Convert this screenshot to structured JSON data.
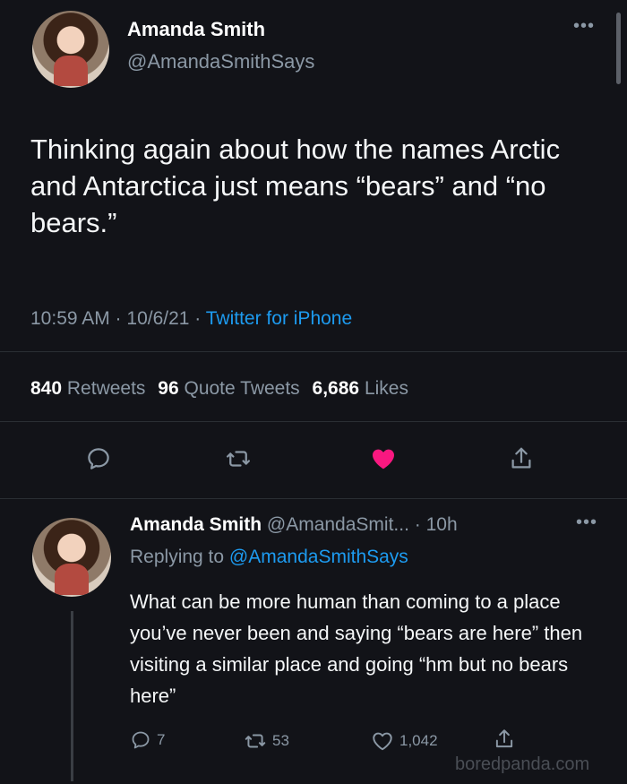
{
  "tweet": {
    "author_name": "Amanda Smith",
    "author_handle": "@AmandaSmithSays",
    "more_label": "•••",
    "text": "Thinking again about how the names Arctic and Antarctica just means “bears” and “no bears.”",
    "time": "10:59 AM · 10/6/21 · ",
    "source": "Twitter for iPhone",
    "stats": {
      "retweets_count": "840",
      "retweets_label": "Retweets",
      "quotes_count": "96",
      "quotes_label": "Quote Tweets",
      "likes_count": "6,686",
      "likes_label": "Likes"
    },
    "actions": [
      "reply-icon",
      "retweet-icon",
      "heart-icon",
      "share-icon"
    ],
    "liked": true,
    "colors": {
      "like": "#f91880",
      "link": "#1d9bf0",
      "muted": "#8b98a5"
    }
  },
  "reply": {
    "author_name": "Amanda Smith",
    "author_handle": "@AmandaSmit...",
    "time": "· 10h",
    "more_label": "•••",
    "replying_prefix": "Replying to ",
    "replying_to": "@AmandaSmithSays",
    "text": "What can be more human than coming to a place you’ve never been and saying “bears are here” then visiting a similar place and going “hm but no bears here”",
    "reply_count": "7",
    "retweet_count": "53",
    "like_count": "1,042"
  },
  "watermark": "boredpanda.com"
}
